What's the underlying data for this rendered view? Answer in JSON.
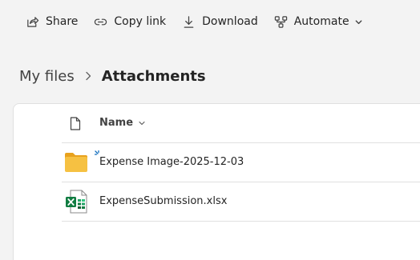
{
  "toolbar": {
    "share_label": "Share",
    "copy_link_label": "Copy link",
    "download_label": "Download",
    "automate_label": "Automate"
  },
  "breadcrumb": {
    "root": "My files",
    "current": "Attachments"
  },
  "list": {
    "name_header": "Name",
    "files": [
      {
        "name": "Expense Image-2025-12-03",
        "icon": "folder-icon"
      },
      {
        "name": "ExpenseSubmission.xlsx",
        "icon": "excel-file-icon"
      }
    ]
  },
  "colors": {
    "folder": "#f6c142",
    "excel": "#107c41",
    "accent": "#0f6cbd"
  }
}
